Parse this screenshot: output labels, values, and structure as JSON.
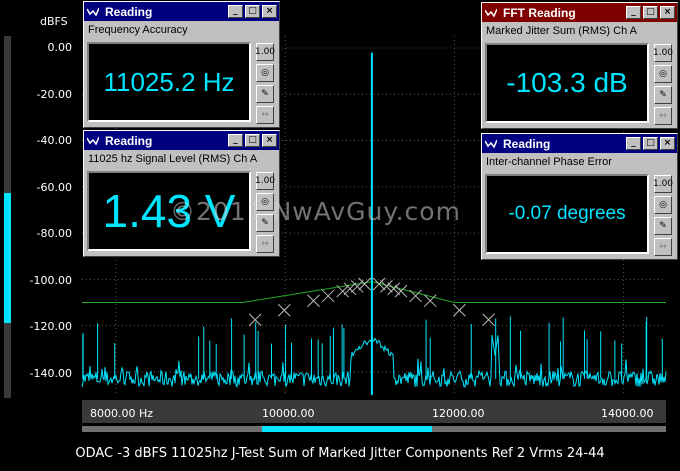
{
  "y_axis": {
    "unit_label": "dBFS",
    "ticks": [
      "0.00",
      "-20.00",
      "-40.00",
      "-60.00",
      "-80.00",
      "-100.00",
      "-120.00",
      "-140.00"
    ]
  },
  "x_axis": {
    "ticks": [
      "8000.00 Hz",
      "10000.00",
      "12000.00",
      "14000.00"
    ]
  },
  "caption": "ODAC -3 dBFS 11025hz J-Test Sum of Marked Jitter Components Ref 2 Vrms 24-44",
  "watermark": "©2011 NwAvGuy.com",
  "windows": {
    "freq_accuracy": {
      "title": "Reading",
      "subtitle": "Frequency Accuracy",
      "value": "11025.2 Hz"
    },
    "signal_level": {
      "title": "Reading",
      "subtitle": "11025 hz Signal Level (RMS) Ch A",
      "value": "1.43 V"
    },
    "fft_reading": {
      "title": "FFT Reading",
      "subtitle": "Marked Jitter Sum (RMS) Ch A",
      "value": "-103.3 dB"
    },
    "phase_error": {
      "title": "Reading",
      "subtitle": "Inter-channel Phase Error",
      "value": "-0.07 degrees"
    }
  },
  "window_buttons": {
    "minimize": "_",
    "maximize": "□",
    "close": "×"
  },
  "side_buttons": {
    "units": "1.00",
    "target": "◎",
    "edit": "✎",
    "arrows": "↔"
  },
  "colors": {
    "trace": "#00e5ff",
    "limit_line": "#22aa22",
    "grid": "#555555",
    "active_title": "#000080",
    "fft_title": "#800000",
    "marker": "#bbbbbb"
  },
  "chart_data": {
    "type": "line",
    "xlim": [
      7600,
      14500
    ],
    "ylim": [
      -150,
      0
    ],
    "series": [
      {
        "values_x": [
          7600,
          9500,
          11025,
          12000,
          14500
        ],
        "values_y": [
          -110,
          -110,
          -101,
          -110,
          -110
        ]
      },
      {
        "values_x": [
          11025
        ],
        "values_y": [
          -2
        ]
      }
    ],
    "noise_floor_db": -143,
    "secondary_peak": {
      "x": 12480,
      "y": -133
    },
    "jitter_markers_x": [
      9646,
      9990,
      10335,
      10508,
      10680,
      10766,
      10852,
      10939,
      11111,
      11197,
      11283,
      11369,
      11541,
      11714,
      12059,
      12404
    ]
  }
}
